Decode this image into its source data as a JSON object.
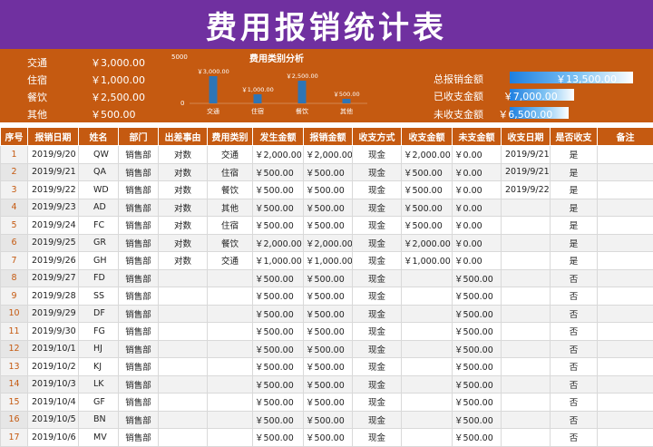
{
  "title": "费用报销统计表",
  "summary": {
    "categories": [
      {
        "label": "交通",
        "amount": "￥3,000.00"
      },
      {
        "label": "住宿",
        "amount": "￥1,000.00"
      },
      {
        "label": "餐饮",
        "amount": "￥2,500.00"
      },
      {
        "label": "其他",
        "amount": "￥500.00"
      }
    ],
    "totals": [
      {
        "label": "总报销金额",
        "amount": "￥13,500.00",
        "fill": 1.0
      },
      {
        "label": "已收支金额",
        "amount": "￥7,000.00",
        "fill": 0.52
      },
      {
        "label": "未收支金额",
        "amount": "￥6,500.00",
        "fill": 0.48
      }
    ]
  },
  "chart_data": {
    "type": "bar",
    "title": "费用类别分析",
    "categories": [
      "交通",
      "住宿",
      "餐饮",
      "其他"
    ],
    "values": [
      3000,
      1000,
      2500,
      500
    ],
    "data_labels": [
      "￥3,000.00",
      "￥1,000.00",
      "￥2,500.00",
      "￥500.00"
    ],
    "yticks": [
      "5000",
      "0"
    ],
    "ylim": [
      0,
      5000
    ],
    "bar_color": "#2e75b6"
  },
  "table": {
    "headers": [
      "序号",
      "报销日期",
      "姓名",
      "部门",
      "出差事由",
      "费用类别",
      "发生金额",
      "报销金额",
      "收支方式",
      "收支金额",
      "未支金额",
      "收支日期",
      "是否收支",
      "备注"
    ],
    "rows": [
      [
        "1",
        "2019/9/20",
        "QW",
        "销售部",
        "对数",
        "交通",
        "￥2,000.00",
        "￥2,000.00",
        "现金",
        "￥2,000.00",
        "￥0.00",
        "2019/9/21",
        "是",
        ""
      ],
      [
        "2",
        "2019/9/21",
        "QA",
        "销售部",
        "对数",
        "住宿",
        "￥500.00",
        "￥500.00",
        "现金",
        "￥500.00",
        "￥0.00",
        "2019/9/21",
        "是",
        ""
      ],
      [
        "3",
        "2019/9/22",
        "WD",
        "销售部",
        "对数",
        "餐饮",
        "￥500.00",
        "￥500.00",
        "现金",
        "￥500.00",
        "￥0.00",
        "2019/9/22",
        "是",
        ""
      ],
      [
        "4",
        "2019/9/23",
        "AD",
        "销售部",
        "对数",
        "其他",
        "￥500.00",
        "￥500.00",
        "现金",
        "￥500.00",
        "￥0.00",
        "",
        "是",
        ""
      ],
      [
        "5",
        "2019/9/24",
        "FC",
        "销售部",
        "对数",
        "住宿",
        "￥500.00",
        "￥500.00",
        "现金",
        "￥500.00",
        "￥0.00",
        "",
        "是",
        ""
      ],
      [
        "6",
        "2019/9/25",
        "GR",
        "销售部",
        "对数",
        "餐饮",
        "￥2,000.00",
        "￥2,000.00",
        "现金",
        "￥2,000.00",
        "￥0.00",
        "",
        "是",
        ""
      ],
      [
        "7",
        "2019/9/26",
        "GH",
        "销售部",
        "对数",
        "交通",
        "￥1,000.00",
        "￥1,000.00",
        "现金",
        "￥1,000.00",
        "￥0.00",
        "",
        "是",
        ""
      ],
      [
        "8",
        "2019/9/27",
        "FD",
        "销售部",
        "",
        "",
        "￥500.00",
        "￥500.00",
        "现金",
        "",
        "￥500.00",
        "",
        "否",
        ""
      ],
      [
        "9",
        "2019/9/28",
        "SS",
        "销售部",
        "",
        "",
        "￥500.00",
        "￥500.00",
        "现金",
        "",
        "￥500.00",
        "",
        "否",
        ""
      ],
      [
        "10",
        "2019/9/29",
        "DF",
        "销售部",
        "",
        "",
        "￥500.00",
        "￥500.00",
        "现金",
        "",
        "￥500.00",
        "",
        "否",
        ""
      ],
      [
        "11",
        "2019/9/30",
        "FG",
        "销售部",
        "",
        "",
        "￥500.00",
        "￥500.00",
        "现金",
        "",
        "￥500.00",
        "",
        "否",
        ""
      ],
      [
        "12",
        "2019/10/1",
        "HJ",
        "销售部",
        "",
        "",
        "￥500.00",
        "￥500.00",
        "现金",
        "",
        "￥500.00",
        "",
        "否",
        ""
      ],
      [
        "13",
        "2019/10/2",
        "KJ",
        "销售部",
        "",
        "",
        "￥500.00",
        "￥500.00",
        "现金",
        "",
        "￥500.00",
        "",
        "否",
        ""
      ],
      [
        "14",
        "2019/10/3",
        "LK",
        "销售部",
        "",
        "",
        "￥500.00",
        "￥500.00",
        "现金",
        "",
        "￥500.00",
        "",
        "否",
        ""
      ],
      [
        "15",
        "2019/10/4",
        "GF",
        "销售部",
        "",
        "",
        "￥500.00",
        "￥500.00",
        "现金",
        "",
        "￥500.00",
        "",
        "否",
        ""
      ],
      [
        "16",
        "2019/10/5",
        "BN",
        "销售部",
        "",
        "",
        "￥500.00",
        "￥500.00",
        "现金",
        "",
        "￥500.00",
        "",
        "否",
        ""
      ],
      [
        "17",
        "2019/10/6",
        "MV",
        "销售部",
        "",
        "",
        "￥500.00",
        "￥500.00",
        "现金",
        "",
        "￥500.00",
        "",
        "否",
        ""
      ]
    ]
  }
}
